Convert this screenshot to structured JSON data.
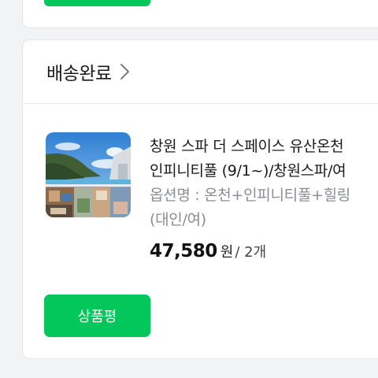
{
  "colors": {
    "accent": "#03c75a",
    "page_background": "#f2f3f5",
    "option_text": "#8a8d93"
  },
  "delivered_section": {
    "status_label": "배송완료",
    "status_chevron_icon": "chevron-right-icon",
    "product": {
      "name_line1": "창원 스파 더 스페이스 유산온천",
      "name_line2": "인피니티풀 (9/1~)/창원스파/여",
      "option_line1": "옵션명 : 온천+인피니티풀+힐링",
      "option_line2": "(대인/여)",
      "price": "47,580",
      "price_unit": "원",
      "quantity": " / 2개",
      "thumbnail_icon": "product-photo"
    },
    "review_button_label": "상품평"
  }
}
